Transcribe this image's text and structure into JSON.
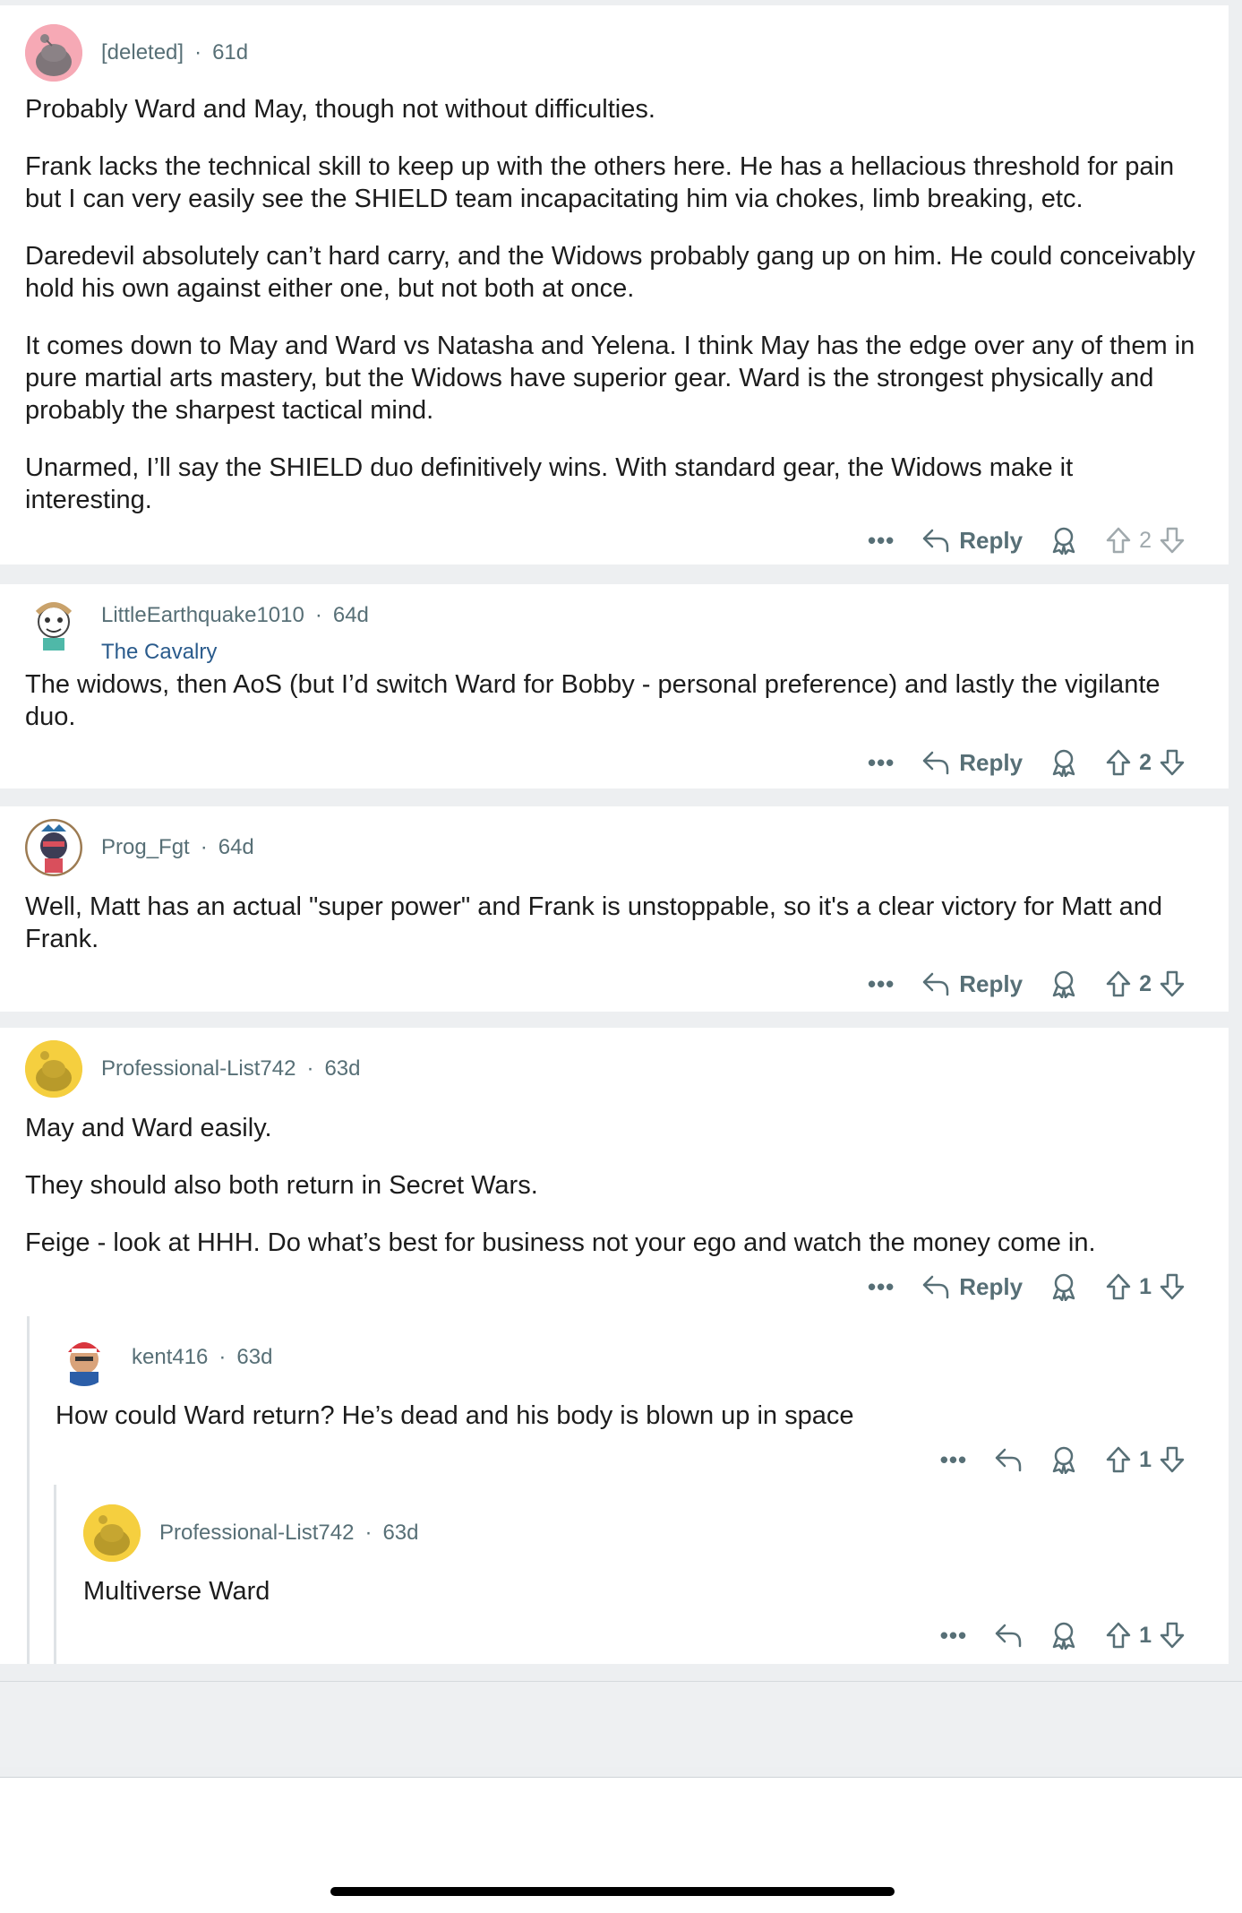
{
  "comments": [
    {
      "username": "[deleted]",
      "age": "61d",
      "paragraphs": [
        "Probably Ward and May, though not without difficulties.",
        "Frank lacks the technical skill to keep up with the others here. He has a hellacious threshold for pain but I can very easily see the SHIELD team incapacitating him via chokes, limb breaking, etc.",
        "Daredevil absolutely can’t hard carry, and the Widows probably gang up on him. He could conceivably hold his own against either one, but not both at once.",
        "It comes down to May and Ward vs Natasha and Yelena. I think May has the edge over any of them in pure martial arts mastery, but the Widows have superior gear. Ward is the strongest physically and probably the sharpest tactical mind.",
        "Unarmed, I’ll say the SHIELD duo definitively wins. With standard gear, the Widows make it interesting."
      ],
      "reply_label": "Reply",
      "score": "2"
    },
    {
      "username": "LittleEarthquake1010",
      "age": "64d",
      "flair": "The Cavalry",
      "paragraphs": [
        "The widows, then AoS (but I’d switch Ward for Bobby - personal preference) and lastly the vigilante duo."
      ],
      "reply_label": "Reply",
      "score": "2"
    },
    {
      "username": "Prog_Fgt",
      "age": "64d",
      "paragraphs": [
        "Well, Matt has an actual \"super power\" and Frank is unstoppable, so it's a clear victory for Matt and Frank."
      ],
      "reply_label": "Reply",
      "score": "2"
    },
    {
      "username": "Professional-List742",
      "age": "63d",
      "paragraphs": [
        "May and Ward easily.",
        "They should also both return in Secret Wars.",
        "Feige - look at HHH. Do what’s best for business not your ego and watch the money come in."
      ],
      "reply_label": "Reply",
      "score": "1"
    },
    {
      "username": "kent416",
      "age": "63d",
      "paragraphs": [
        "How could Ward return? He’s dead and his body is blown up in space"
      ],
      "score": "1"
    },
    {
      "username": "Professional-List742",
      "age": "63d",
      "paragraphs": [
        "Multiverse Ward"
      ],
      "score": "1"
    }
  ],
  "separator": "·",
  "more_label": "•••",
  "colors": {
    "meta": "#576f76",
    "flair": "#2a5b8c",
    "background": "#edeff1",
    "card": "#ffffff"
  },
  "icons": [
    "avatar",
    "reply-arrow-icon",
    "award-icon",
    "upvote-icon",
    "downvote-icon",
    "more-icon"
  ]
}
